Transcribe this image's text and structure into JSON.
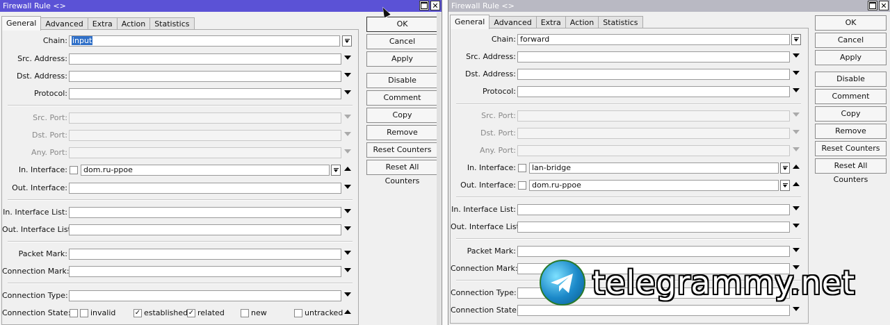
{
  "watermark": "telegrammy.net",
  "windows": [
    {
      "title": "Firewall Rule <>",
      "tabs": [
        "General",
        "Advanced",
        "Extra",
        "Action",
        "Statistics"
      ],
      "buttons": [
        "OK",
        "Cancel",
        "Apply",
        "Disable",
        "Comment",
        "Copy",
        "Remove",
        "Reset Counters",
        "Reset All Counters"
      ],
      "fields": {
        "chain": {
          "label": "Chain:",
          "value": "input"
        },
        "src_address": {
          "label": "Src. Address:",
          "value": ""
        },
        "dst_address": {
          "label": "Dst. Address:",
          "value": ""
        },
        "protocol": {
          "label": "Protocol:",
          "value": ""
        },
        "src_port": {
          "label": "Src. Port:",
          "value": ""
        },
        "dst_port": {
          "label": "Dst. Port:",
          "value": ""
        },
        "any_port": {
          "label": "Any. Port:",
          "value": ""
        },
        "in_interface": {
          "label": "In. Interface:",
          "value": "dom.ru-ppoe"
        },
        "out_interface": {
          "label": "Out. Interface:",
          "value": ""
        },
        "in_interface_list": {
          "label": "In. Interface List:",
          "value": ""
        },
        "out_interface_list": {
          "label": "Out. Interface List:",
          "value": ""
        },
        "packet_mark": {
          "label": "Packet Mark:",
          "value": ""
        },
        "connection_mark": {
          "label": "Connection Mark:",
          "value": ""
        },
        "connection_type": {
          "label": "Connection Type:",
          "value": ""
        },
        "connection_state": {
          "label": "Connection State:"
        }
      },
      "states": [
        {
          "label": "invalid",
          "checked": false
        },
        {
          "label": "established",
          "checked": true
        },
        {
          "label": "related",
          "checked": true
        },
        {
          "label": "new",
          "checked": false
        },
        {
          "label": "untracked",
          "checked": false
        }
      ]
    },
    {
      "title": "Firewall Rule <>",
      "tabs": [
        "General",
        "Advanced",
        "Extra",
        "Action",
        "Statistics"
      ],
      "buttons": [
        "OK",
        "Cancel",
        "Apply",
        "Disable",
        "Comment",
        "Copy",
        "Remove",
        "Reset Counters",
        "Reset All Counters"
      ],
      "fields": {
        "chain": {
          "label": "Chain:",
          "value": "forward"
        },
        "src_address": {
          "label": "Src. Address:",
          "value": ""
        },
        "dst_address": {
          "label": "Dst. Address:",
          "value": ""
        },
        "protocol": {
          "label": "Protocol:",
          "value": ""
        },
        "src_port": {
          "label": "Src. Port:",
          "value": ""
        },
        "dst_port": {
          "label": "Dst. Port:",
          "value": ""
        },
        "any_port": {
          "label": "Any. Port:",
          "value": ""
        },
        "in_interface": {
          "label": "In. Interface:",
          "value": "lan-bridge"
        },
        "out_interface": {
          "label": "Out. Interface:",
          "value": "dom.ru-ppoe"
        },
        "in_interface_list": {
          "label": "In. Interface List:",
          "value": ""
        },
        "out_interface_list": {
          "label": "Out. Interface List:",
          "value": ""
        },
        "packet_mark": {
          "label": "Packet Mark:",
          "value": ""
        },
        "connection_mark": {
          "label": "Connection Mark:",
          "value": ""
        },
        "connection_type": {
          "label": "Connection Type:",
          "value": ""
        },
        "connection_state": {
          "label": "Connection State:"
        }
      }
    }
  ]
}
